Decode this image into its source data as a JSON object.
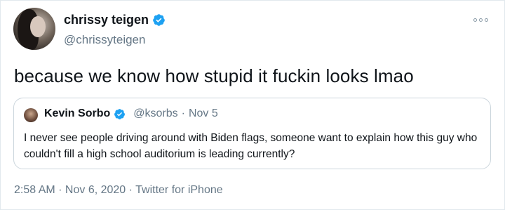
{
  "author": {
    "display_name": "chrissy teigen",
    "handle": "@chrissyteigen",
    "verified": true
  },
  "tweet_text": "because we know how stupid it fuckin looks lmao",
  "quoted_tweet": {
    "display_name": "Kevin Sorbo",
    "handle": "@ksorbs",
    "date": "Nov 5",
    "separator": "·",
    "verified": true,
    "text": "I never see people driving around with Biden flags, someone want to explain how this guy who couldn't fill a high school auditorium is leading currently?"
  },
  "footer": {
    "text": "2:58 AM · Nov 6, 2020 · Twitter for iPhone"
  },
  "colors": {
    "verified_blue": "#1da1f2",
    "secondary_text": "#657786",
    "border": "#ccd6dd"
  },
  "icons": {
    "more": "more-options-icon",
    "verified": "verified-badge-icon"
  }
}
